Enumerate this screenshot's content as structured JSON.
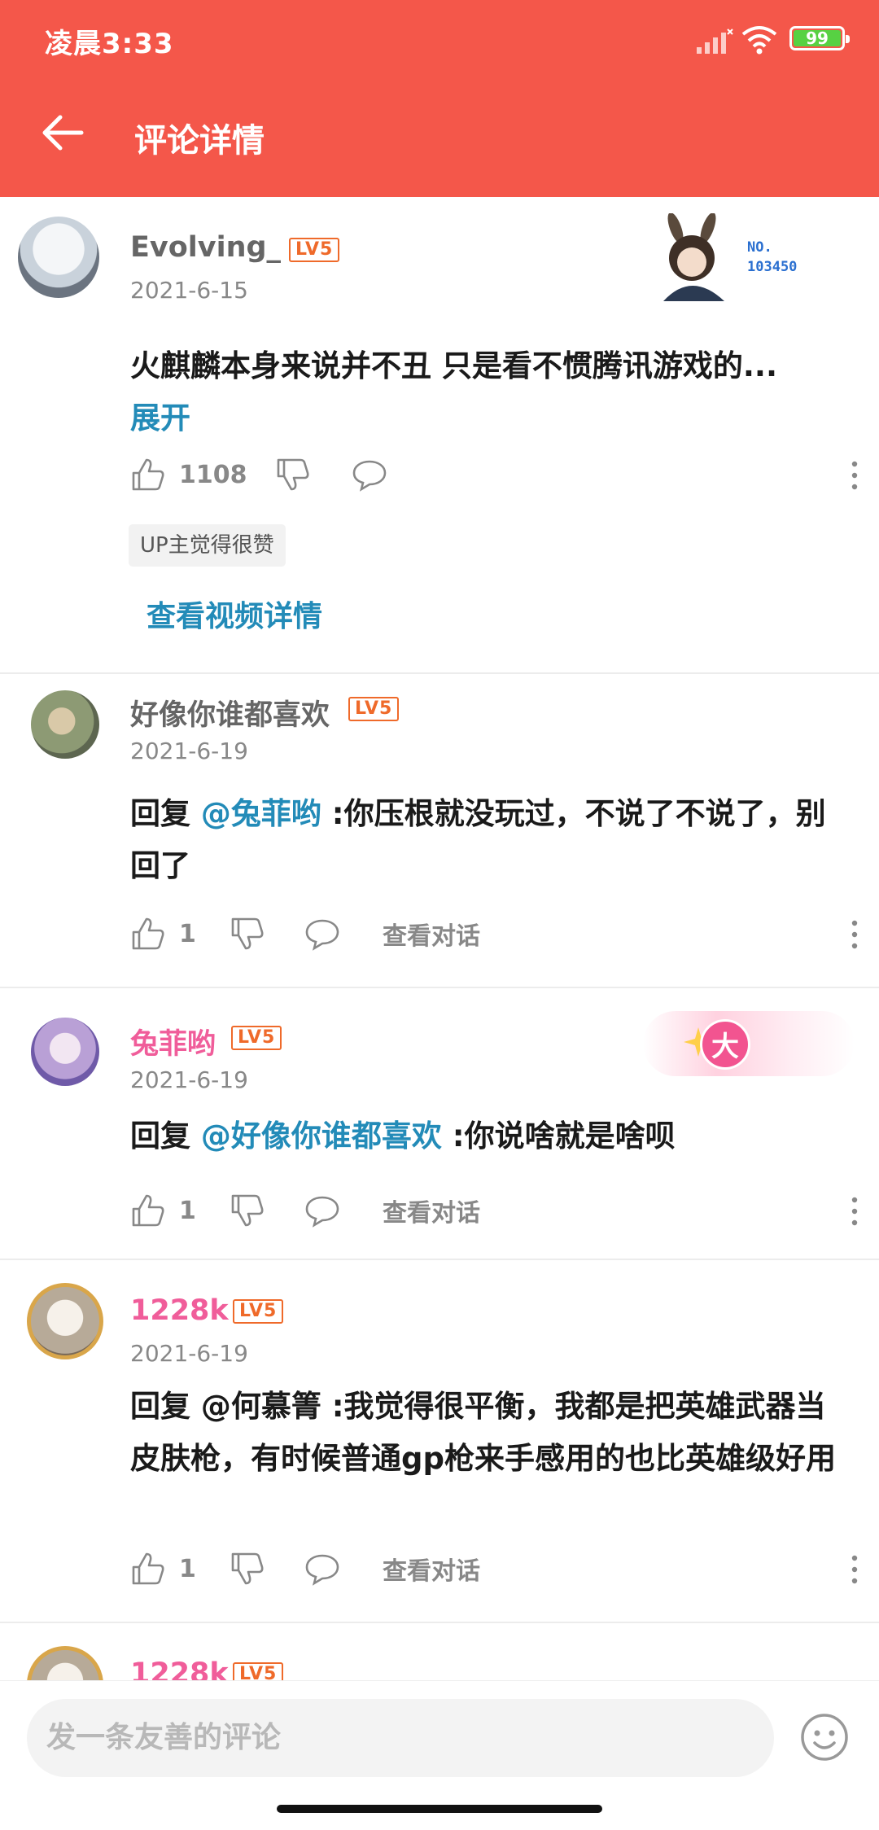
{
  "status": {
    "time": "凌晨3:33",
    "battery": "99"
  },
  "header": {
    "title": "评论详情"
  },
  "comments": [
    {
      "username": "Evolving_",
      "level": "LV5",
      "date": "2021-6-15",
      "badge": "NO.\n103450",
      "content": "火麒麟本身来说并不丑  只是看不惯腾讯游戏的...",
      "expand": "展开",
      "likes": "1108",
      "tag": "UP主觉得很赞",
      "view_video": "查看视频详情"
    },
    {
      "username": "好像你谁都喜欢",
      "level": "LV5",
      "date": "2021-6-19",
      "reply_prefix": "回复 ",
      "mention": "@兔菲哟",
      "content": " :你压根就没玩过，不说了不说了，别回了",
      "likes": "1",
      "view_conversation": "查看对话"
    },
    {
      "username": "兔菲哟",
      "level": "LV5",
      "date": "2021-6-19",
      "reply_prefix": "回复 ",
      "mention": "@好像你谁都喜欢",
      "content": " :你说啥就是啥呗",
      "likes": "1",
      "view_conversation": "查看对话",
      "badge": "大"
    },
    {
      "username": "1228k",
      "level": "LV5",
      "date": "2021-6-19",
      "content": "回复 @何慕箐 :我觉得很平衡，我都是把英雄武器当皮肤枪，有时候普通gp枪来手感用的也比英雄级好用",
      "likes": "1",
      "view_conversation": "查看对话"
    },
    {
      "username": "1228k",
      "level": "LV5"
    }
  ],
  "composer": {
    "placeholder": "发一条友善的评论"
  },
  "colors": {
    "accent": "#f4574a",
    "link": "#238bb8",
    "vip_pink": "#f05d9a",
    "level": "#ef6a2a"
  }
}
